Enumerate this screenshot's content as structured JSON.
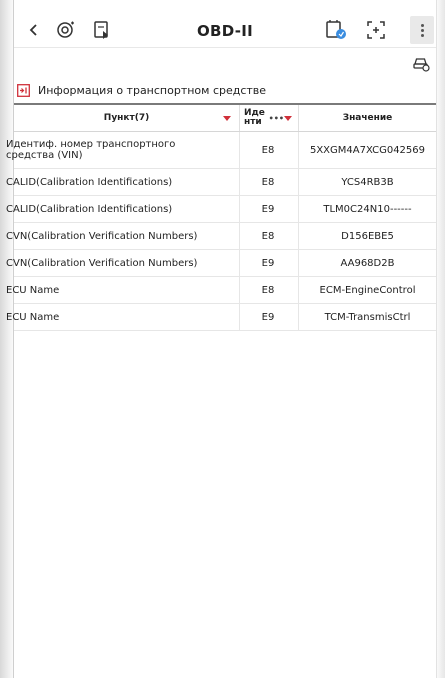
{
  "header": {
    "title": "OBD-II"
  },
  "section": {
    "label": "Информация о транспортном средстве"
  },
  "table": {
    "columns": [
      "Пункт(7)",
      "Иде нти",
      "Значение"
    ],
    "id_col_line1": "Иде",
    "id_col_line2": "нти",
    "rows": [
      {
        "item": "Идентиф. номер транспортного средства (VIN)",
        "item_line1": "Идентиф. номер транспортного",
        "item_line2": "средства (VIN)",
        "id": "E8",
        "value": "5XXGM4A7XCG042569"
      },
      {
        "item": "CALID(Calibration Identifications)",
        "id": "E8",
        "value": "YCS4RB3B"
      },
      {
        "item": "CALID(Calibration Identifications)",
        "id": "E9",
        "value": "TLM0C24N10------"
      },
      {
        "item": "CVN(Calibration Verification Numbers)",
        "id": "E8",
        "value": "D156EBE5"
      },
      {
        "item": "CVN(Calibration Verification Numbers)",
        "id": "E9",
        "value": "AA968D2B"
      },
      {
        "item": "ECU Name",
        "id": "E8",
        "value": "ECM-EngineControl"
      },
      {
        "item": "ECU Name",
        "id": "E9",
        "value": "TCM-TransmisCtrl"
      }
    ]
  },
  "colors": {
    "accent_red": "#d0303a",
    "header_rule": "#7a7a7a"
  },
  "icons": [
    "back-icon",
    "vehicle-settings-icon",
    "export-icon",
    "report-icon",
    "screenshot-icon",
    "more-icon",
    "car-search-icon",
    "section-info-icon",
    "sort-icon"
  ]
}
